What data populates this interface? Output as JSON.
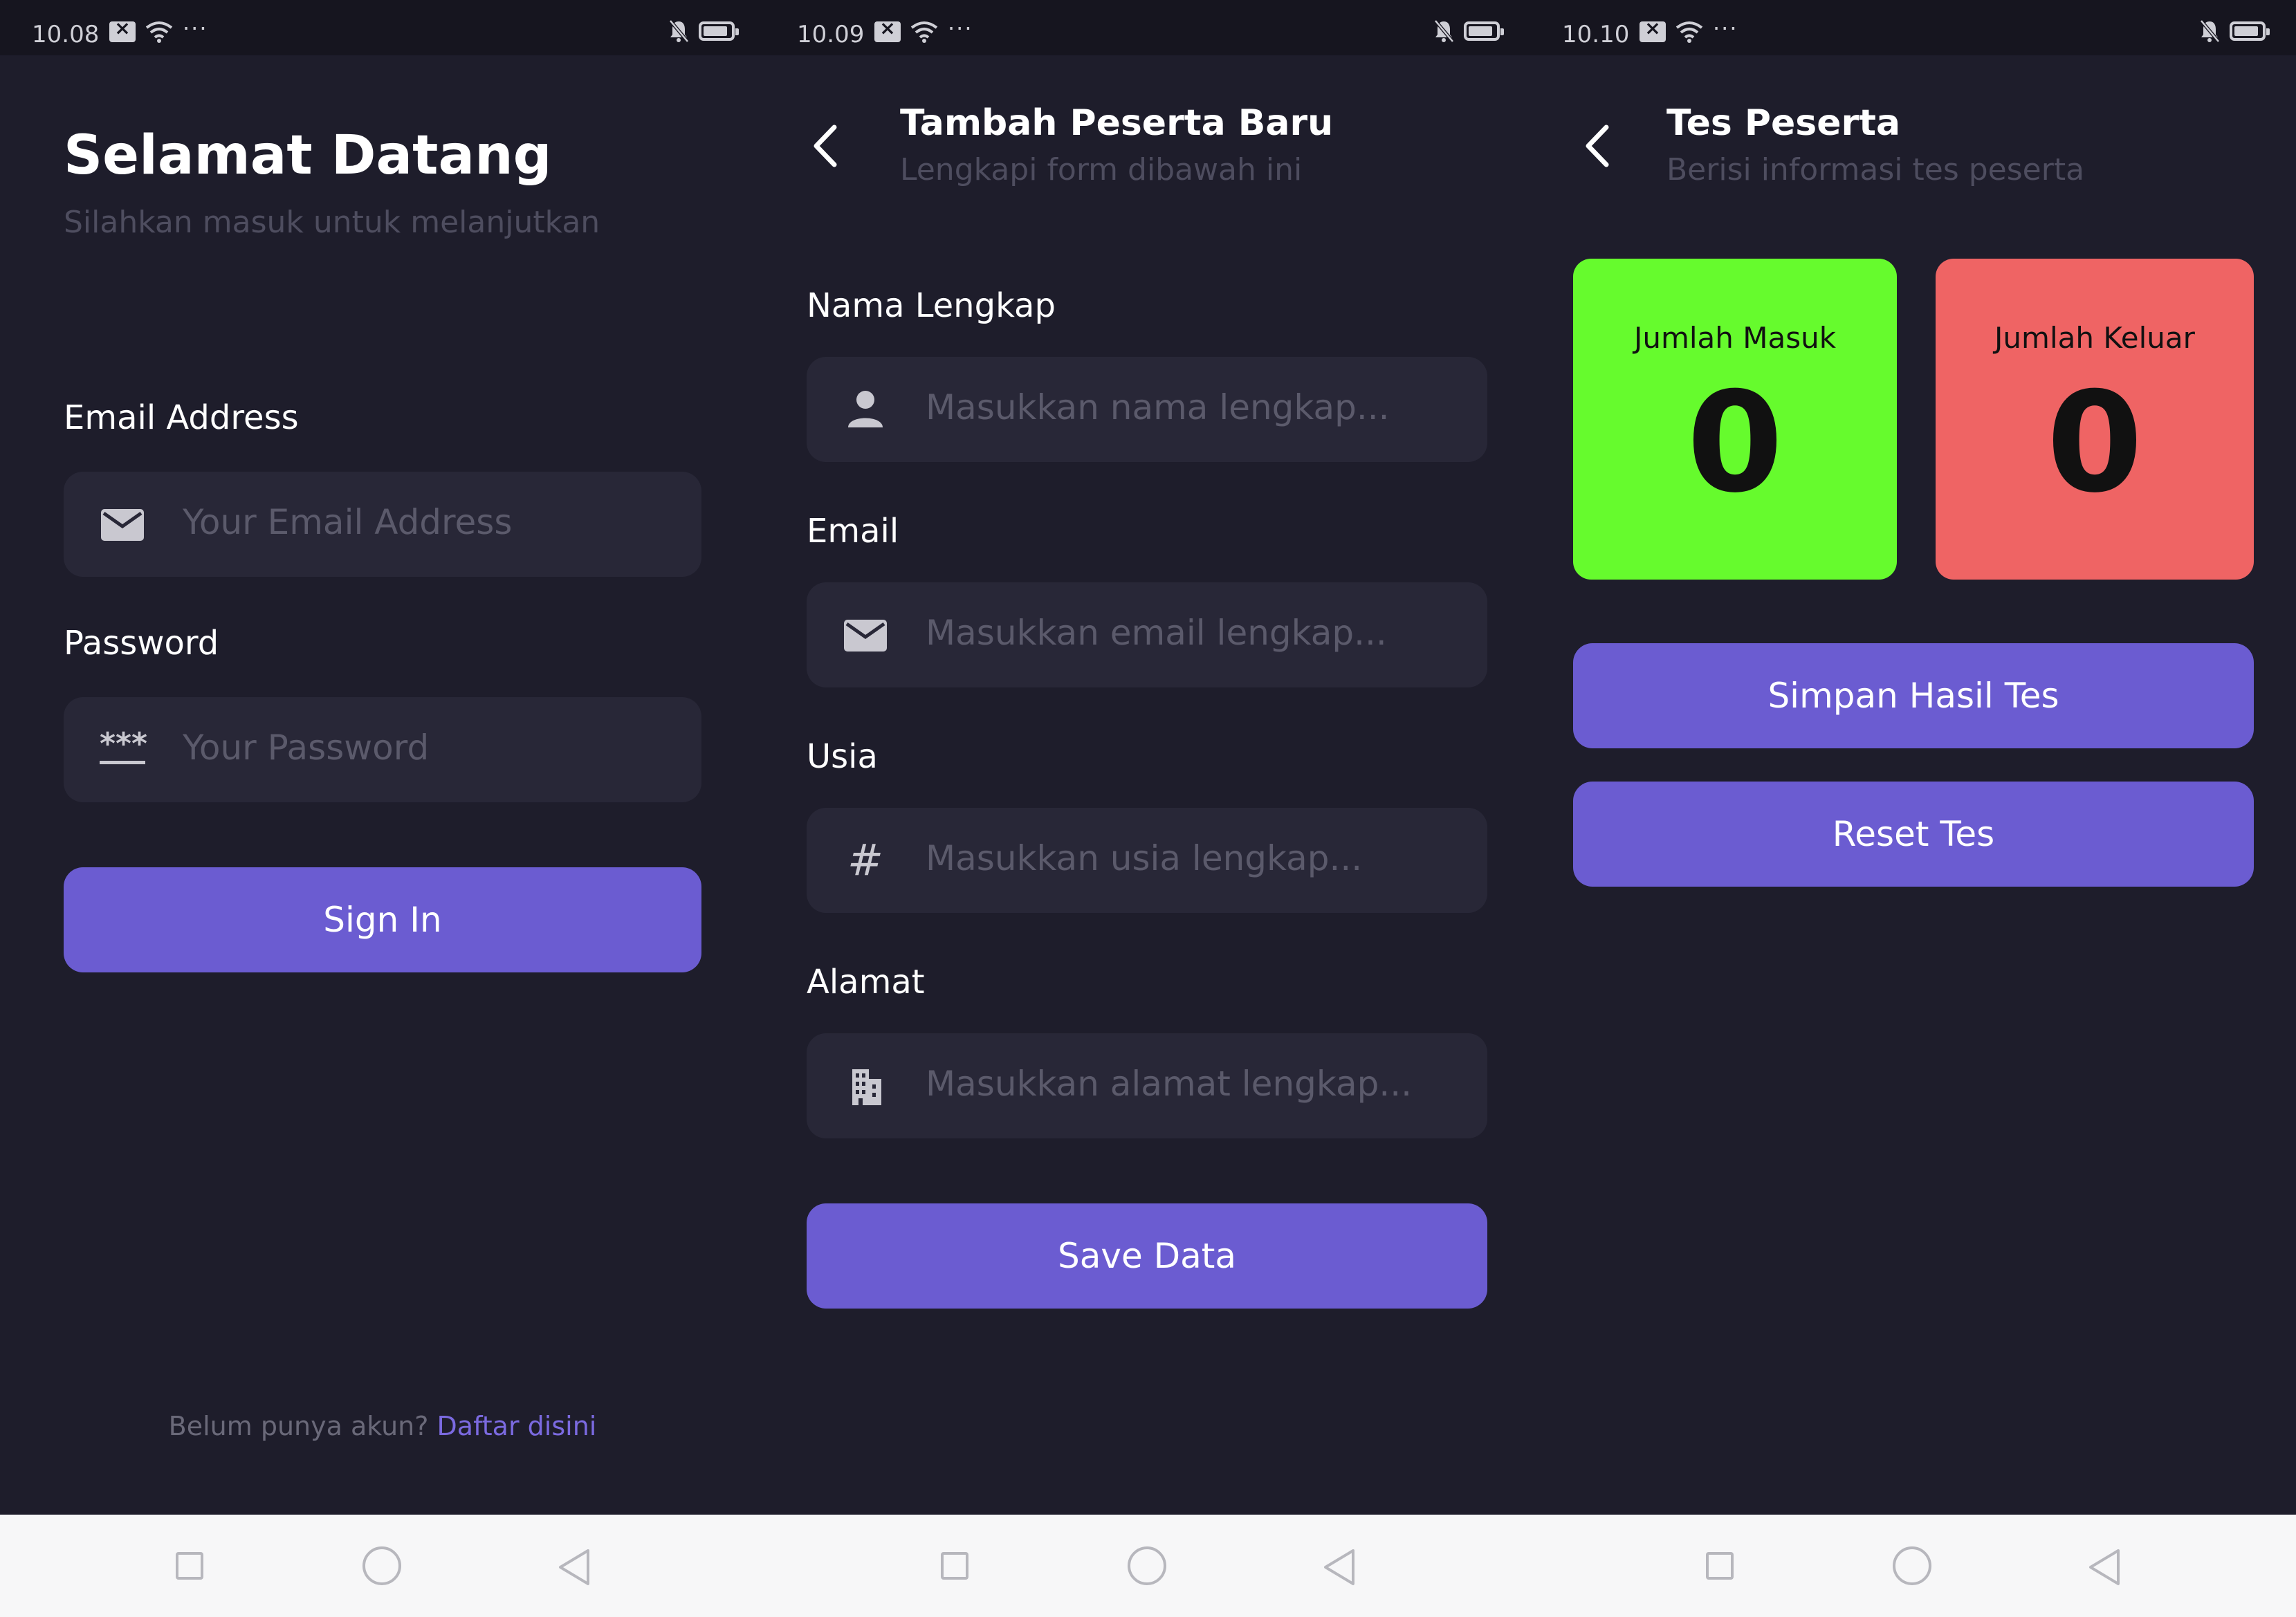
{
  "screens": [
    {
      "status": {
        "time": "10.08"
      },
      "title": "Selamat Datang",
      "subtitle": "Silahkan masuk untuk melanjutkan",
      "fields": [
        {
          "label": "Email Address",
          "placeholder": "Your Email Address",
          "icon": "mail-icon"
        },
        {
          "label": "Password",
          "placeholder": "Your Password",
          "icon": "password-icon",
          "icon_text": "***"
        }
      ],
      "button": "Sign In",
      "footer": {
        "text": "Belum punya akun? ",
        "link": "Daftar disini"
      }
    },
    {
      "status": {
        "time": "10.09"
      },
      "title": "Tambah Peserta Baru",
      "subtitle": "Lengkapi form dibawah ini",
      "fields": [
        {
          "label": "Nama Lengkap",
          "placeholder": "Masukkan nama lengkap...",
          "icon": "person-icon"
        },
        {
          "label": "Email",
          "placeholder": "Masukkan email lengkap...",
          "icon": "mail-icon"
        },
        {
          "label": "Usia",
          "placeholder": "Masukkan usia lengkap...",
          "icon": "hash-icon",
          "icon_text": "#"
        },
        {
          "label": "Alamat",
          "placeholder": "Masukkan alamat lengkap...",
          "icon": "building-icon"
        }
      ],
      "button": "Save Data"
    },
    {
      "status": {
        "time": "10.10"
      },
      "title": "Tes Peserta",
      "subtitle": "Berisi informasi tes peserta",
      "cards": [
        {
          "label": "Jumlah Masuk",
          "value": "0",
          "color": "#66fb2d"
        },
        {
          "label": "Jumlah Keluar",
          "value": "0",
          "color": "#ef6464"
        }
      ],
      "buttons": [
        "Simpan Hasil Tes",
        "Reset Tes"
      ]
    }
  ],
  "status_dots": "···",
  "theme": {
    "background": "#1e1d2b",
    "field": "#282737",
    "accent": "#6b5cd1",
    "link": "#7b6ae0",
    "muted": "#4e4d5f"
  }
}
